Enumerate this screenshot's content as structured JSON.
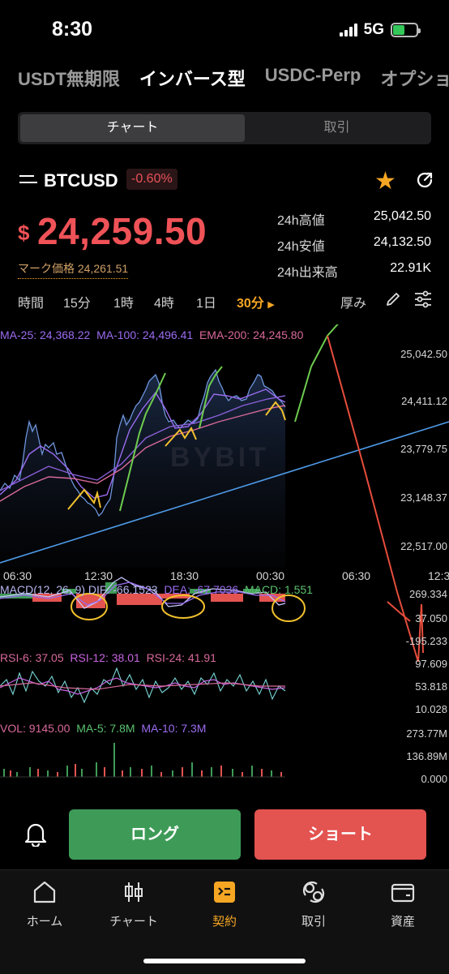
{
  "status": {
    "time": "8:30",
    "network": "5G"
  },
  "market_tabs": [
    "USDT無期限",
    "インバース型",
    "USDC-Perp",
    "オプショ"
  ],
  "segment": {
    "chart": "チャート",
    "trade": "取引"
  },
  "symbol": {
    "name": "BTCUSD",
    "change": "-0.60%",
    "currency": "$",
    "price": "24,259.50",
    "mark_label": "マーク価格",
    "mark_value": "24,261.51"
  },
  "stats": [
    {
      "label": "24h高値",
      "value": "25,042.50"
    },
    {
      "label": "24h安値",
      "value": "24,132.50"
    },
    {
      "label": "24h出来高",
      "value": "22.91K"
    }
  ],
  "timeframes": [
    "時間",
    "15分",
    "1時",
    "4時",
    "1日",
    "30分"
  ],
  "depth_label": "厚み",
  "ma": {
    "ma25": "MA-25: 24,368.22",
    "ma100": "MA-100: 24,496.41",
    "ema200": "EMA-200: 24,245.80"
  },
  "price_axis": [
    "25,042.50",
    "24,411.12",
    "23,779.75",
    "23,148.37",
    "22,517.00"
  ],
  "time_axis": [
    "06:30",
    "12:30",
    "18:30",
    "00:30",
    "06:30",
    "12:3"
  ],
  "watermark": "BYBIT",
  "macd": {
    "title": "MACD(12, 26, 9) DIF: -66.1523",
    "dea": "DEA: -67.7036",
    "macd": "MACD: 1.551",
    "axis": [
      "269.334",
      "37.050",
      "-195.233"
    ]
  },
  "rsi": {
    "rsi6": "RSI-6: 37.05",
    "rsi12": "RSI-12: 38.01",
    "rsi24": "RSI-24: 41.91",
    "axis": [
      "97.609",
      "53.818",
      "10.028"
    ]
  },
  "vol": {
    "vol": "VOL: 9145.00",
    "ma5": "MA-5: 7.8M",
    "ma10": "MA-10: 7.3M",
    "axis": [
      "273.77M",
      "136.89M",
      "0.000"
    ]
  },
  "buttons": {
    "long": "ロング",
    "short": "ショート"
  },
  "tabbar": [
    {
      "label": "ホーム",
      "icon": "home-icon"
    },
    {
      "label": "チャート",
      "icon": "candlestick-icon"
    },
    {
      "label": "契約",
      "icon": "contract-icon"
    },
    {
      "label": "取引",
      "icon": "trade-icon"
    },
    {
      "label": "資産",
      "icon": "wallet-icon"
    }
  ],
  "colors": {
    "up": "#3e9b57",
    "down": "#e35350",
    "accent": "#f5a623",
    "price": "#ef5257"
  }
}
